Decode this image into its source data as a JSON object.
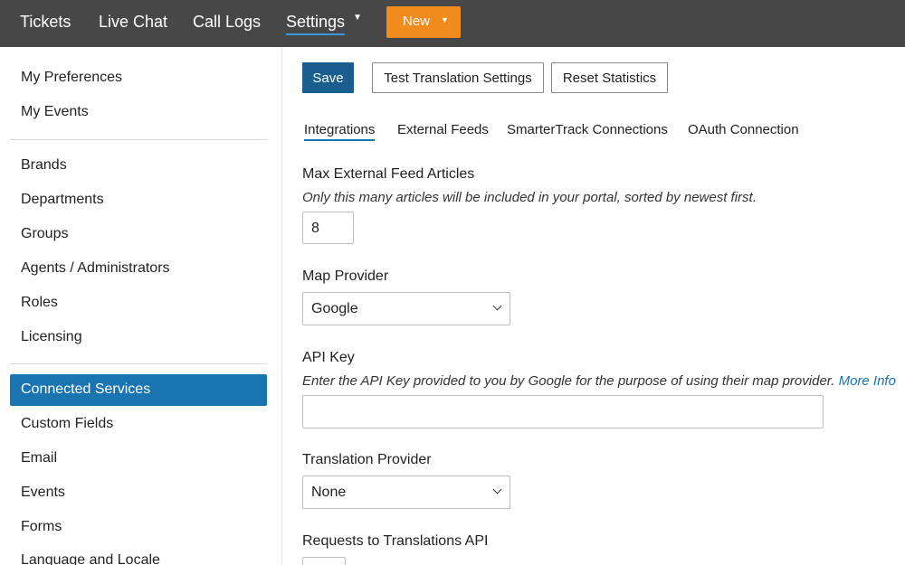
{
  "topnav": {
    "items": [
      "Tickets",
      "Live Chat",
      "Call Logs",
      "Settings"
    ],
    "new_label": "New"
  },
  "sidebar": {
    "group1": [
      "My Preferences",
      "My Events"
    ],
    "group2": [
      "Brands",
      "Departments",
      "Groups",
      "Agents / Administrators",
      "Roles",
      "Licensing"
    ],
    "active": "Connected Services",
    "group3": [
      "Custom Fields",
      "Email",
      "Events",
      "Forms",
      "Language and Locale"
    ]
  },
  "toolbar": {
    "save_label": "Save",
    "test_label": "Test Translation Settings",
    "reset_label": "Reset Statistics"
  },
  "tabs": [
    "Integrations",
    "External Feeds",
    "SmarterTrack Connections",
    "OAuth Connection"
  ],
  "form": {
    "max_feed": {
      "label": "Max External Feed Articles",
      "hint": "Only this many articles will be included in your portal, sorted by newest first.",
      "value": "8"
    },
    "map_provider": {
      "label": "Map Provider",
      "value": "Google"
    },
    "api_key": {
      "label": "API Key",
      "hint": "Enter the API Key provided to you by Google for the purpose of using their map provider.",
      "link": "More Info",
      "value": ""
    },
    "translation_provider": {
      "label": "Translation Provider",
      "value": "None"
    },
    "requests_label": "Requests to Translations API"
  },
  "colors": {
    "topbar": "#474747",
    "new_button": "#f28b1d",
    "active_nav": "#1a74b0",
    "save_button": "#1a5d8f"
  }
}
